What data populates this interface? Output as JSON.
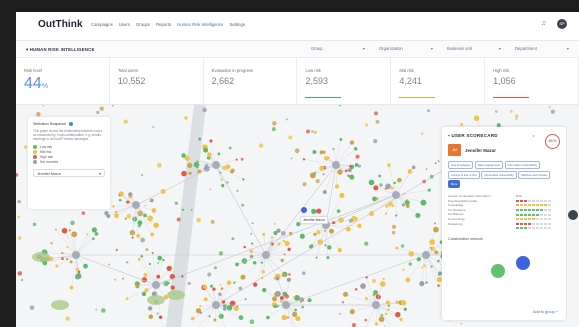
{
  "app": {
    "logo": "OutThink",
    "nav": [
      {
        "label": "Campaigns",
        "active": false
      },
      {
        "label": "Users",
        "active": false
      },
      {
        "label": "Groups",
        "active": false
      },
      {
        "label": "Reports",
        "active": false
      },
      {
        "label": "Human Risk Intelligence",
        "active": true
      },
      {
        "label": "Settings",
        "active": false
      }
    ],
    "user_initials": "SP",
    "bell_icon": "bell-icon"
  },
  "subbar": {
    "title": "HUMAN RISK INTELLIGENCE",
    "filters": [
      "Group",
      "Organization",
      "Business unit",
      "Department"
    ]
  },
  "stats": [
    {
      "label": "Risk level",
      "value": "44",
      "suffix": "%",
      "color": "#5c93e0"
    },
    {
      "label": "Total users",
      "value": "10,552",
      "bar_color": ""
    },
    {
      "label": "Evaluation in progress",
      "value": "2,662",
      "bar_color": ""
    },
    {
      "label": "Low risk",
      "value": "2,593",
      "bar_color": "#3fb06a"
    },
    {
      "label": "Mid risk",
      "value": "4,241",
      "bar_color": "#f0a13a"
    },
    {
      "label": "High risk",
      "value": "1,056",
      "bar_color": "#e2574c"
    }
  ],
  "legend": {
    "title": "Selection Snapshot",
    "description": "This graph shows the relationship between users as measured by 'cross-collaboration' e.g. emails, meetings & ad-hoc/IP teams messages",
    "items": [
      {
        "label": "Low risk",
        "color": "#5fb86b"
      },
      {
        "label": "Mid risk",
        "color": "#f3c244"
      },
      {
        "label": "High risk",
        "color": "#e2574c"
      },
      {
        "label": "Not involved",
        "color": "#9aa0a8"
      }
    ],
    "selected_user": "Jennifer Mazur"
  },
  "graph": {
    "node_tag": "Jennifer Mazur"
  },
  "scorecard": {
    "title": "USER SCORECARD",
    "score": "61%",
    "initials": "JM",
    "name": "Jennifer Mazur",
    "tags": [
      "Low knowledge",
      "Data engagement",
      "Information vulnerability",
      "Access to lots of info",
      "Information vulnerability",
      "Matches with threats",
      "More"
    ],
    "metric_header": "Risk",
    "metrics": [
      "Access to sensitive information",
      "Psychographic profile",
      "Knowledge",
      "Competence",
      "Confidence",
      "Connectivity",
      "Sustaining"
    ],
    "collab_title": "Collaboration network",
    "add_to_group": "Add to group +"
  }
}
